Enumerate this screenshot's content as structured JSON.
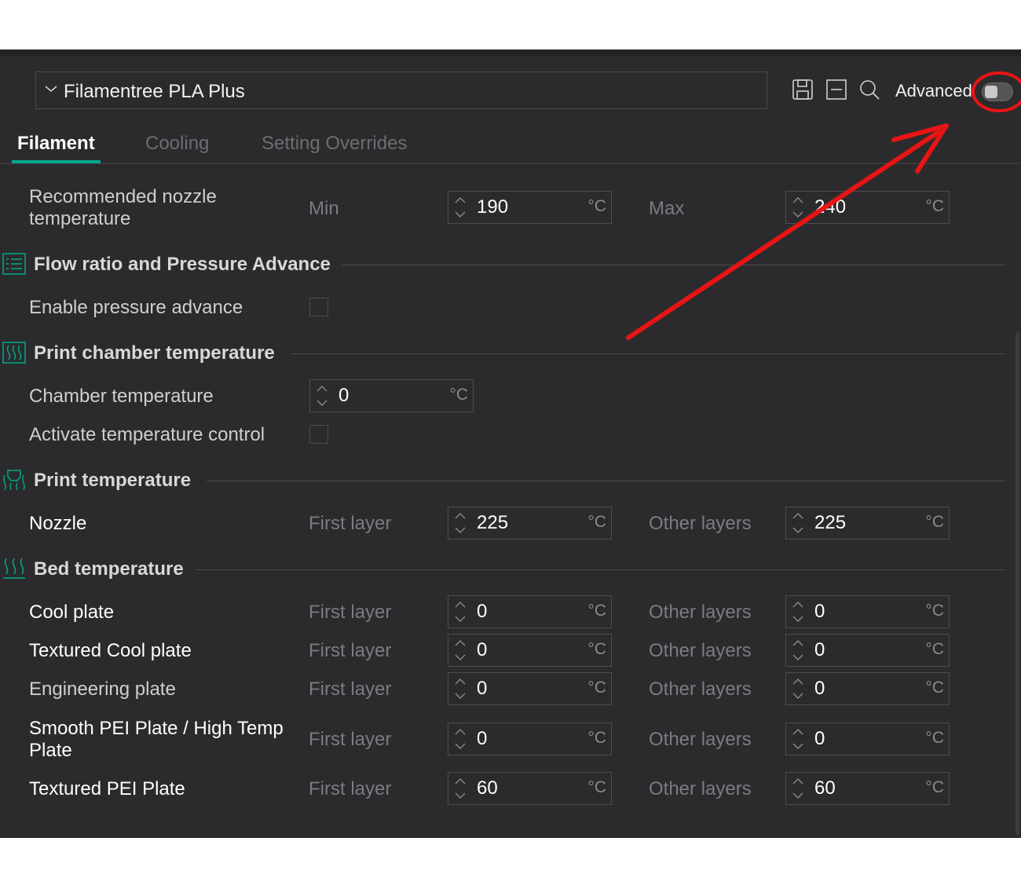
{
  "preset": {
    "name": "Filamentree PLA Plus"
  },
  "toolbar": {
    "advanced_label": "Advanced",
    "advanced_on": false
  },
  "tabs": [
    {
      "label": "Filament",
      "active": true
    },
    {
      "label": "Cooling",
      "active": false
    },
    {
      "label": "Setting Overrides",
      "active": false
    }
  ],
  "nozzle_range": {
    "label_line1": "Recommended nozzle",
    "label_line2": "temperature",
    "min_label": "Min",
    "min_value": "190",
    "min_unit": "°C",
    "max_label": "Max",
    "max_value": "240",
    "max_unit": "°C"
  },
  "flow_section": {
    "title": "Flow ratio and Pressure Advance",
    "pressure_advance_label": "Enable pressure advance",
    "pressure_advance_checked": false
  },
  "chamber_section": {
    "title": "Print chamber temperature",
    "chamber_temp_label": "Chamber temperature",
    "chamber_temp_value": "0",
    "chamber_temp_unit": "°C",
    "activate_label": "Activate temperature control",
    "activate_checked": false
  },
  "print_temp_section": {
    "title": "Print temperature",
    "row": {
      "label": "Nozzle",
      "first_label": "First layer",
      "first_value": "225",
      "first_unit": "°C",
      "other_label": "Other layers",
      "other_value": "225",
      "other_unit": "°C"
    }
  },
  "bed_section": {
    "title": "Bed temperature",
    "rows": [
      {
        "label": "Cool plate",
        "first_label": "First layer",
        "first_value": "0",
        "unit": "°C",
        "other_label": "Other layers",
        "other_value": "0"
      },
      {
        "label": "Textured Cool plate",
        "first_label": "First layer",
        "first_value": "0",
        "unit": "°C",
        "other_label": "Other layers",
        "other_value": "0"
      },
      {
        "label": "Engineering plate",
        "first_label": "First layer",
        "first_value": "0",
        "unit": "°C",
        "other_label": "Other layers",
        "other_value": "0"
      },
      {
        "label_line1": "Smooth PEI Plate / High Temp",
        "label_line2": "Plate",
        "first_label": "First layer",
        "first_value": "0",
        "unit": "°C",
        "other_label": "Other layers",
        "other_value": "0"
      },
      {
        "label": "Textured PEI Plate",
        "first_label": "First layer",
        "first_value": "60",
        "unit": "°C",
        "other_label": "Other layers",
        "other_value": "60"
      }
    ]
  },
  "colors": {
    "accent": "#00a98c",
    "annotation": "#e81414",
    "panel_bg": "#2b2b2d"
  },
  "icons": [
    "chevron-down-icon",
    "save-icon",
    "collapse-icon",
    "search-icon",
    "list-icon",
    "chamber-heat-icon",
    "nozzle-heat-icon",
    "bed-heat-icon",
    "spin-arrows-icon"
  ]
}
